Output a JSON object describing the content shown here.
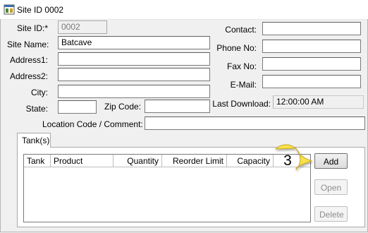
{
  "window": {
    "title": "Site ID 0002"
  },
  "form": {
    "site_id_label": "Site ID:*",
    "site_id_value": "0002",
    "site_name_label": "Site Name:",
    "site_name_value": "Batcave",
    "address1_label": "Address1:",
    "address2_label": "Address2:",
    "city_label": "City:",
    "state_label": "State:",
    "zip_label": "Zip Code:",
    "location_label": "Location Code / Comment:",
    "contact_label": "Contact:",
    "phone_label": "Phone No:",
    "fax_label": "Fax No:",
    "email_label": "E-Mail:",
    "last_download_label": "Last Download:",
    "last_download_value": "12:00:00 AM"
  },
  "tanks": {
    "tab_label": "Tank(s)",
    "columns": [
      "Tank",
      "Product",
      "Quantity",
      "Reorder Limit",
      "Capacity"
    ],
    "rows": [],
    "add_label": "Add",
    "open_label": "Open",
    "delete_label": "Delete"
  },
  "callout": {
    "number": "3",
    "color": "#f9e24b"
  }
}
